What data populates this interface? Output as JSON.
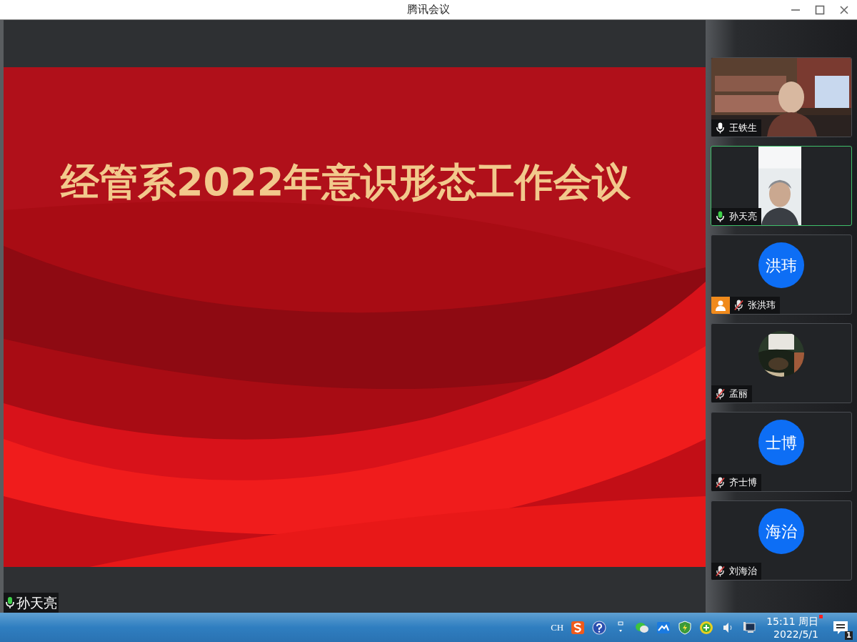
{
  "window": {
    "title": "腾讯会议"
  },
  "slide": {
    "title": "经管系2022年意识形态工作会议"
  },
  "speaker": {
    "name": "孙天亮",
    "muted": false,
    "speaking": true
  },
  "participants": [
    {
      "name": "王铁生",
      "kind": "video",
      "muted": false,
      "speaking": false,
      "selected": false,
      "host": false
    },
    {
      "name": "孙天亮",
      "kind": "video",
      "muted": false,
      "speaking": true,
      "selected": true,
      "host": false
    },
    {
      "name": "张洪玮",
      "kind": "initials",
      "initials": "洪玮",
      "muted": true,
      "speaking": false,
      "selected": false,
      "host": true
    },
    {
      "name": "孟丽",
      "muted": true,
      "speaking": false,
      "selected": false,
      "host": false
    },
    {
      "name": "齐士博",
      "kind": "initials",
      "initials": "士博",
      "muted": true,
      "speaking": false,
      "selected": false,
      "host": false
    },
    {
      "name": "刘海治",
      "kind": "initials",
      "initials": "海治",
      "muted": true,
      "speaking": false,
      "selected": false,
      "host": false
    }
  ],
  "taskbar": {
    "input_language": "CH",
    "time": "15:11 周日",
    "date": "2022/5/1",
    "notification_count": "1",
    "clock_alert": true
  }
}
